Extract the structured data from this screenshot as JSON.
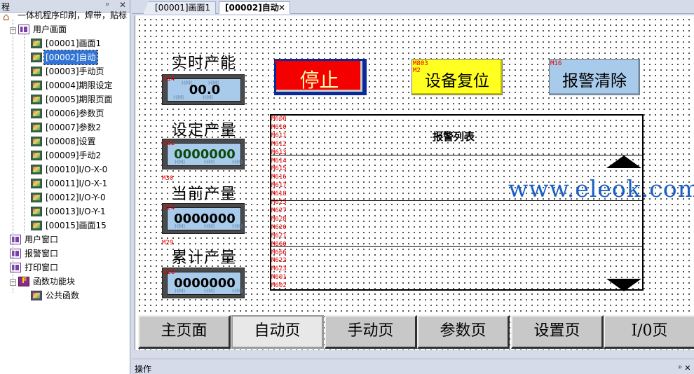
{
  "left_panel": {
    "title": "程",
    "pin": "ᵖ",
    "close": "✕",
    "tree": [
      {
        "label": "一体机程序印刷，焊带，贴标",
        "icon": "home-icon",
        "level": 0
      },
      {
        "label": "用户画面",
        "icon": "folder-icon",
        "level": 1,
        "expander": "−"
      },
      {
        "label": "[00001]画面1",
        "icon": "screen-icon",
        "level": 2
      },
      {
        "label": "[00002]自动",
        "icon": "screen-icon",
        "level": 2,
        "selected": true
      },
      {
        "label": "[00003]手动页",
        "icon": "screen-icon",
        "level": 2
      },
      {
        "label": "[00004]期限设定",
        "icon": "screen-icon",
        "level": 2
      },
      {
        "label": "[00005]期限页面",
        "icon": "screen-icon",
        "level": 2
      },
      {
        "label": "[00006]参数页",
        "icon": "screen-icon",
        "level": 2
      },
      {
        "label": "[00007]参数2",
        "icon": "screen-icon",
        "level": 2
      },
      {
        "label": "[00008]设置",
        "icon": "screen-icon",
        "level": 2
      },
      {
        "label": "[00009]手动2",
        "icon": "screen-icon",
        "level": 2
      },
      {
        "label": "[00010]I/O-X-0",
        "icon": "screen-icon",
        "level": 2
      },
      {
        "label": "[00011]I/O-X-1",
        "icon": "screen-icon",
        "level": 2
      },
      {
        "label": "[00012]I/O-Y-0",
        "icon": "screen-icon",
        "level": 2
      },
      {
        "label": "[00013]I/O-Y-1",
        "icon": "screen-icon",
        "level": 2
      },
      {
        "label": "[00015]画面15",
        "icon": "screen-icon",
        "level": 2
      },
      {
        "label": "用户窗口",
        "icon": "folder-icon",
        "level": 1
      },
      {
        "label": "报警窗口",
        "icon": "folder-icon",
        "level": 1
      },
      {
        "label": "打印窗口",
        "icon": "folder-icon",
        "level": 1
      },
      {
        "label": "函数功能块",
        "icon": "function-icon",
        "level": 1,
        "expander": "−"
      },
      {
        "label": "公共函数",
        "icon": "script-icon",
        "level": 2
      }
    ]
  },
  "tabs": [
    {
      "label": "[00001]画面1",
      "active": false
    },
    {
      "label": "[00002]自动",
      "active": true,
      "close": "✕"
    }
  ],
  "screen": {
    "labels": {
      "realtime": "实时产能",
      "set": "设定产量",
      "current": "当前产量",
      "total": "累计产量"
    },
    "tags": {
      "realtime": "D14",
      "set": "D12",
      "current_label": "M30",
      "current": "D24",
      "total_label": "M29",
      "total": "D28",
      "stop": "M1",
      "reset_a": "M803",
      "reset_b": "M2",
      "clear": "M16"
    },
    "displays": {
      "realtime": "00.0",
      "set": "0000000",
      "current": "0000000",
      "total": "0000000"
    },
    "display_watermark": "HMI",
    "buttons": {
      "stop": "停止",
      "reset": "设备复位",
      "clear": "报警清除"
    },
    "button_colors": {
      "stop": "#f40000",
      "reset": "#ffff22",
      "clear": "#a9cbeb"
    },
    "alarm": {
      "title": "报警列表",
      "tags": [
        "M600",
        "M610",
        "M611",
        "M612",
        "M613",
        "M614",
        "M615",
        "M616",
        "M617",
        "M618",
        "M625",
        "M627",
        "M628",
        "M620",
        "M621",
        "M660",
        "M666",
        "M622",
        "M623",
        "M601",
        "M602"
      ]
    },
    "watermark": "www.eleok.com",
    "nav": [
      "主页面",
      "自动页",
      "手动页",
      "参数页",
      "设置页",
      "I/0页"
    ],
    "nav_current": 1
  },
  "statusbar": {
    "label": "操作",
    "pin": "ᵖ ✕"
  }
}
